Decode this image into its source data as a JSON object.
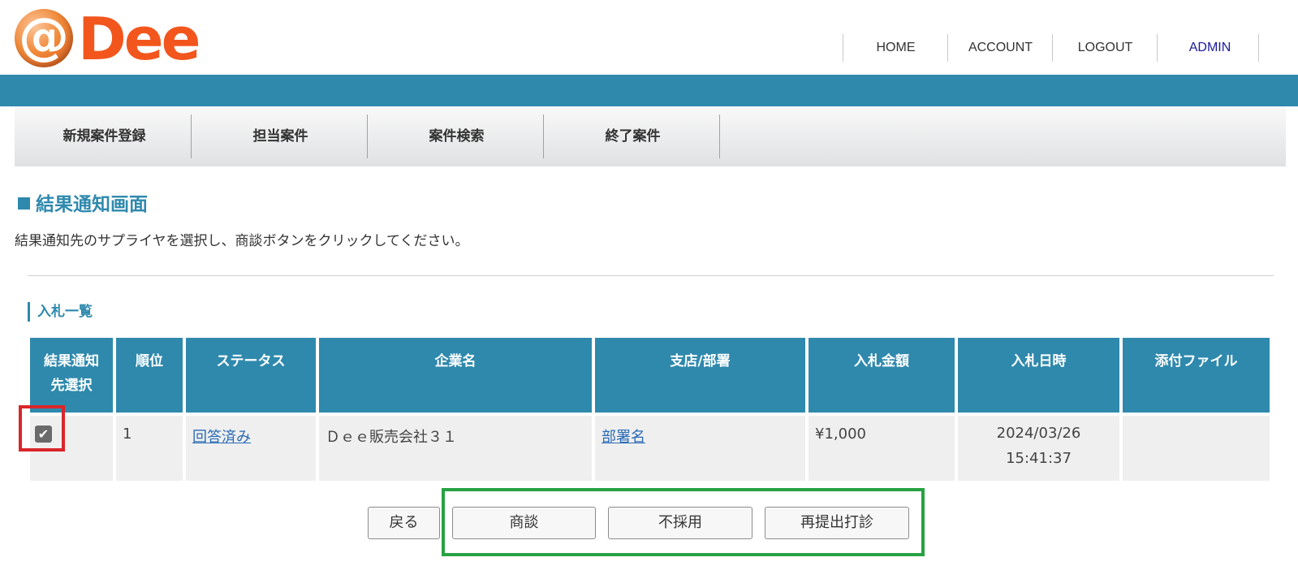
{
  "header": {
    "logo_at": "@",
    "logo_text": "Dee",
    "nav": [
      "HOME",
      "ACCOUNT",
      "LOGOUT",
      "ADMIN"
    ]
  },
  "menu": [
    "新規案件登録",
    "担当案件",
    "案件検索",
    "終了案件"
  ],
  "page": {
    "title": "結果通知画面",
    "description": "結果通知先のサプライヤを選択し、商談ボタンをクリックしてください。",
    "section_title": "入札一覧"
  },
  "table": {
    "headers": [
      "結果通知先選択",
      "順位",
      "ステータス",
      "企業名",
      "支店/部署",
      "入札金額",
      "入札日時",
      "添付ファイル"
    ],
    "rows": [
      {
        "selected": true,
        "rank": "1",
        "status": "回答済み",
        "company": "Ｄｅｅ販売会社３１",
        "department": "部署名",
        "amount": "¥1,000",
        "date": "2024/03/26",
        "time": "15:41:37",
        "attachment": ""
      }
    ]
  },
  "buttons": {
    "back": "戻る",
    "negotiate": "商談",
    "reject": "不採用",
    "resubmit": "再提出打診"
  },
  "colors": {
    "brand_blue": "#2f89ad",
    "logo_orange": "#f2561d",
    "highlight_red": "#d9262b",
    "highlight_green": "#27a244"
  }
}
